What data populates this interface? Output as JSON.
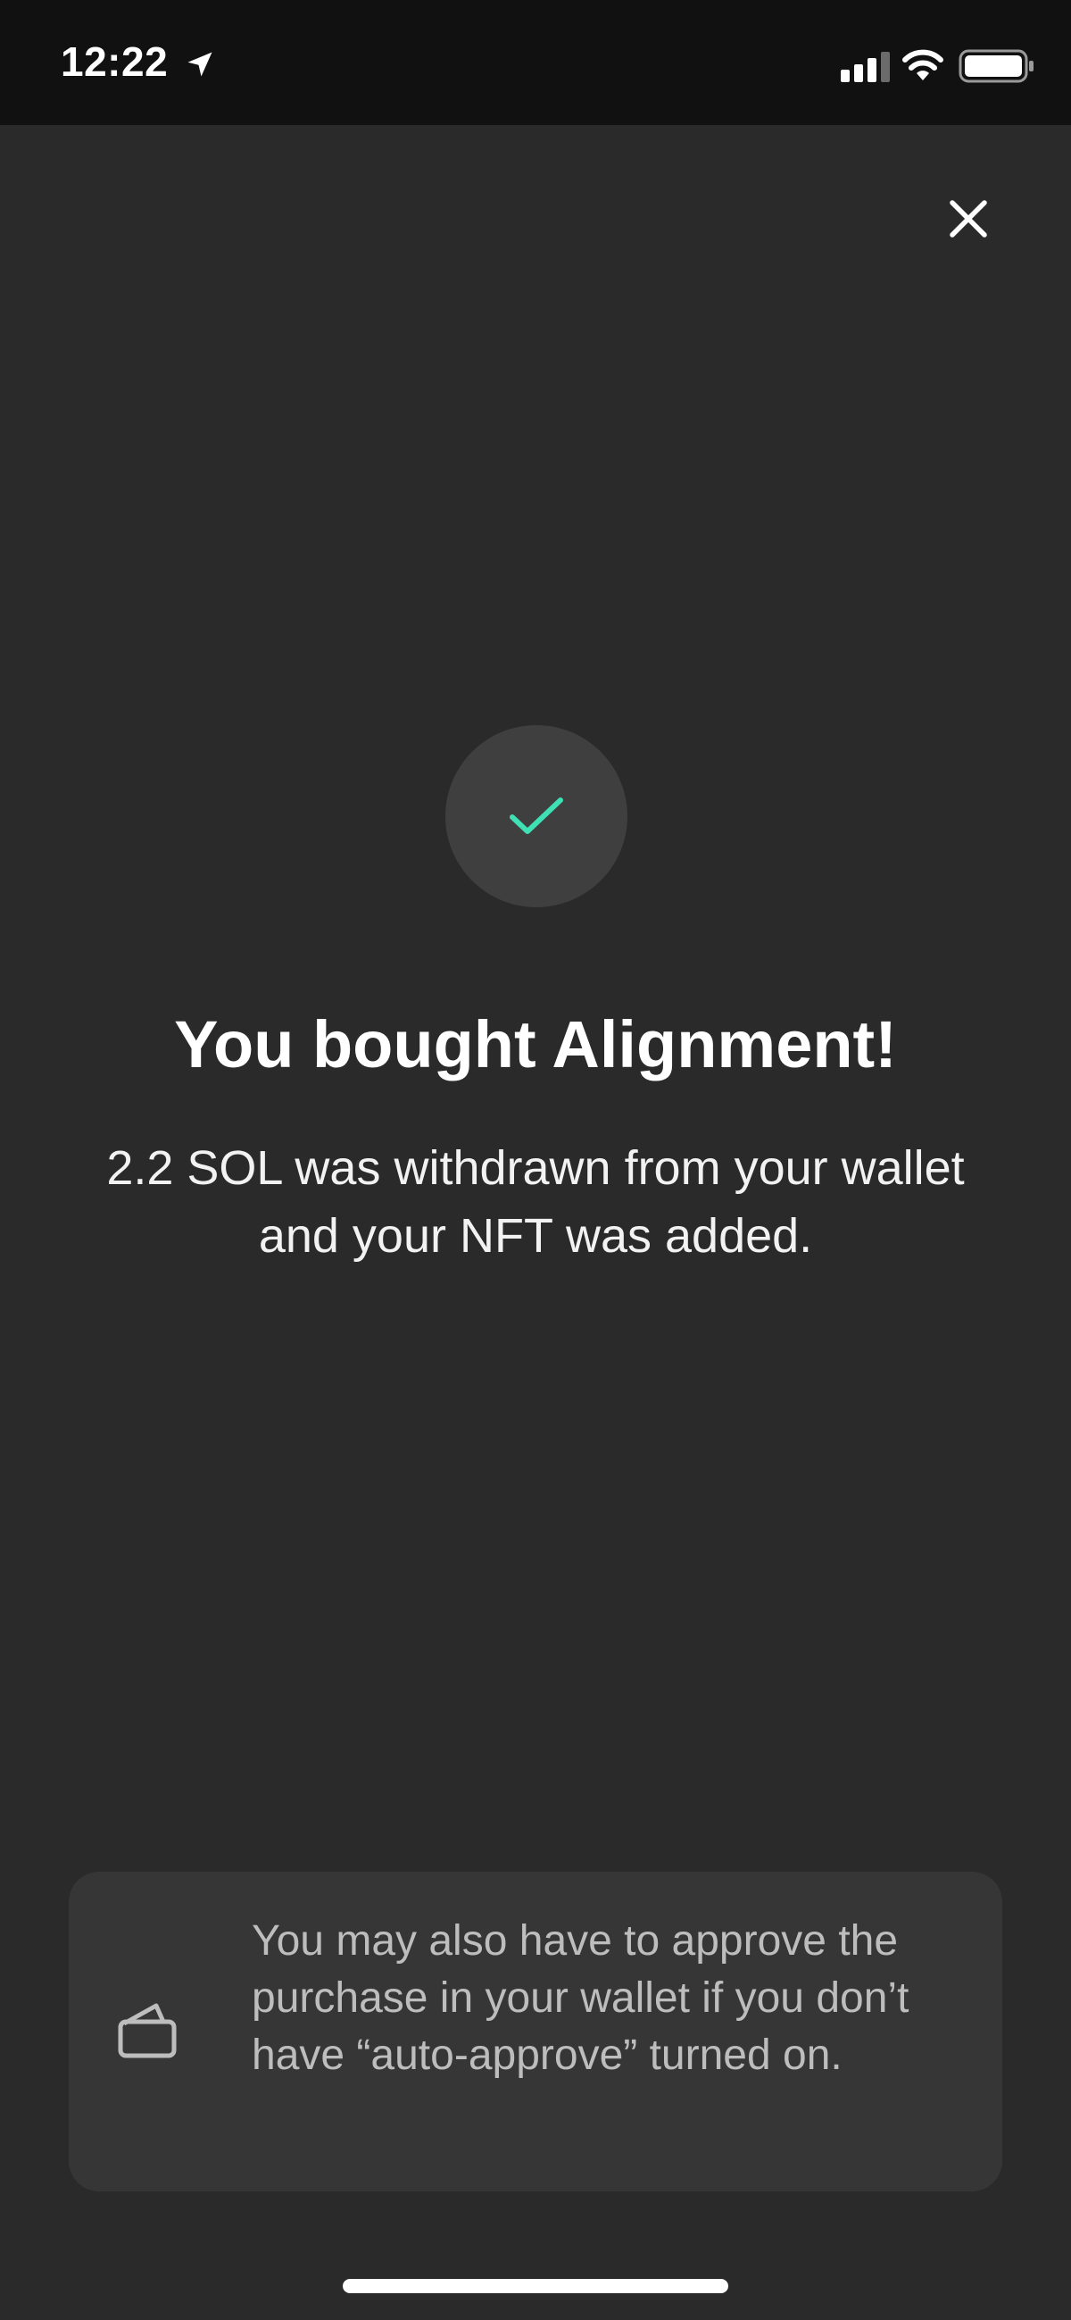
{
  "status_bar": {
    "time": "12:22",
    "location_icon": "location-arrow-icon",
    "signal_icon": "cellular-signal-icon",
    "wifi_icon": "wifi-icon",
    "battery_icon": "battery-icon"
  },
  "header": {
    "close_icon": "close-icon"
  },
  "success": {
    "icon": "checkmark-icon",
    "accent_color": "#3fe0b4",
    "title": "You bought Alignment!",
    "message": "2.2 SOL was withdrawn from your wallet and your NFT was added."
  },
  "info_card": {
    "icon": "wallet-icon",
    "text": "You may also have to approve the purchase in your wallet if you don’t have “auto-approve” turned on."
  },
  "colors": {
    "background": "#2a2a2a",
    "status_bar_bg": "#111111",
    "card_bg": "#363636",
    "circle_bg": "#3f3f3f",
    "accent": "#3fe0b4"
  }
}
